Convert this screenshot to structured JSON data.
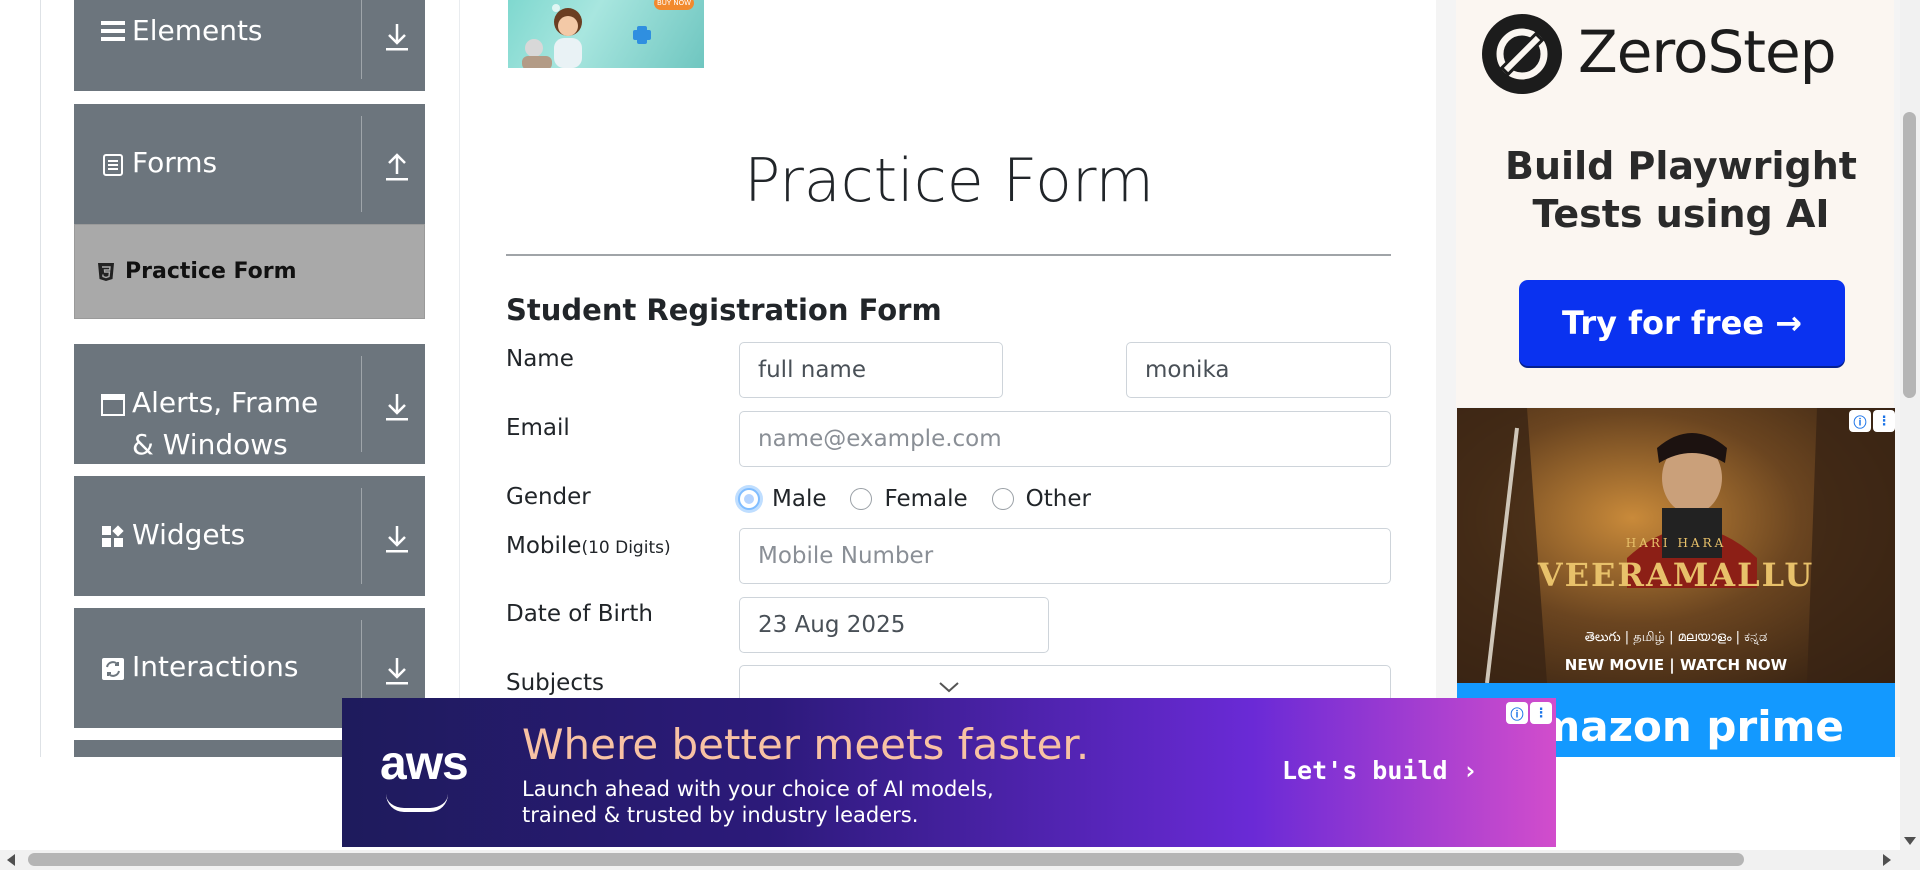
{
  "sidebar": {
    "groups": [
      {
        "label": "Elements",
        "icon": "list-icon",
        "arrow": "download-icon"
      },
      {
        "label": "Forms",
        "icon": "document-icon",
        "arrow": "upload-icon"
      },
      {
        "label": "Alerts, Frame & Windows",
        "icon": "window-icon",
        "arrow": "download-icon"
      },
      {
        "label": "Widgets",
        "icon": "widgets-icon",
        "arrow": "download-icon"
      },
      {
        "label": "Interactions",
        "icon": "interactions-icon",
        "arrow": "download-icon"
      }
    ],
    "active_item": {
      "label": "Practice Form",
      "icon": "html5-icon"
    }
  },
  "main": {
    "page_title": "Practice Form",
    "form_title": "Student Registration Form",
    "name": {
      "label": "Name",
      "first_value": "full name",
      "last_value": "monika"
    },
    "email": {
      "label": "Email",
      "placeholder": "name@example.com"
    },
    "gender": {
      "label": "Gender",
      "options": [
        "Male",
        "Female",
        "Other"
      ],
      "selected": "Male"
    },
    "mobile": {
      "label": "Mobile",
      "hint": "(10 Digits)",
      "placeholder": "Mobile Number"
    },
    "dob": {
      "label": "Date of Birth",
      "value": "23 Aug 2025"
    },
    "subjects": {
      "label": "Subjects"
    },
    "top_ad": {
      "badge": "BUY NOW"
    }
  },
  "ads": {
    "zerostep": {
      "brand": "ZeroStep",
      "line1": "Build Playwright",
      "line2": "Tests using AI",
      "cta": "Try for free →"
    },
    "movie": {
      "pre": "HARI HARA",
      "title": "VEERAMALLU",
      "langs": "తెలుగు | தமிழ் | മലയാളം | ಕನ್ನಡ",
      "tagline": "NEW MOVIE | WATCH NOW",
      "brand": "amazon prime"
    },
    "aws": {
      "logo": "aws",
      "headline": "Where better meets faster.",
      "sub1": "Launch ahead with your choice of AI models,",
      "sub2": "trained & trusted by industry leaders.",
      "cta": "Let's build ›"
    }
  },
  "colors": {
    "sidebar_group": "#6c757d",
    "sidebar_active": "#a9a9a9",
    "zerostep_cta": "#0a32f0",
    "prime_blue": "#1399ff"
  }
}
